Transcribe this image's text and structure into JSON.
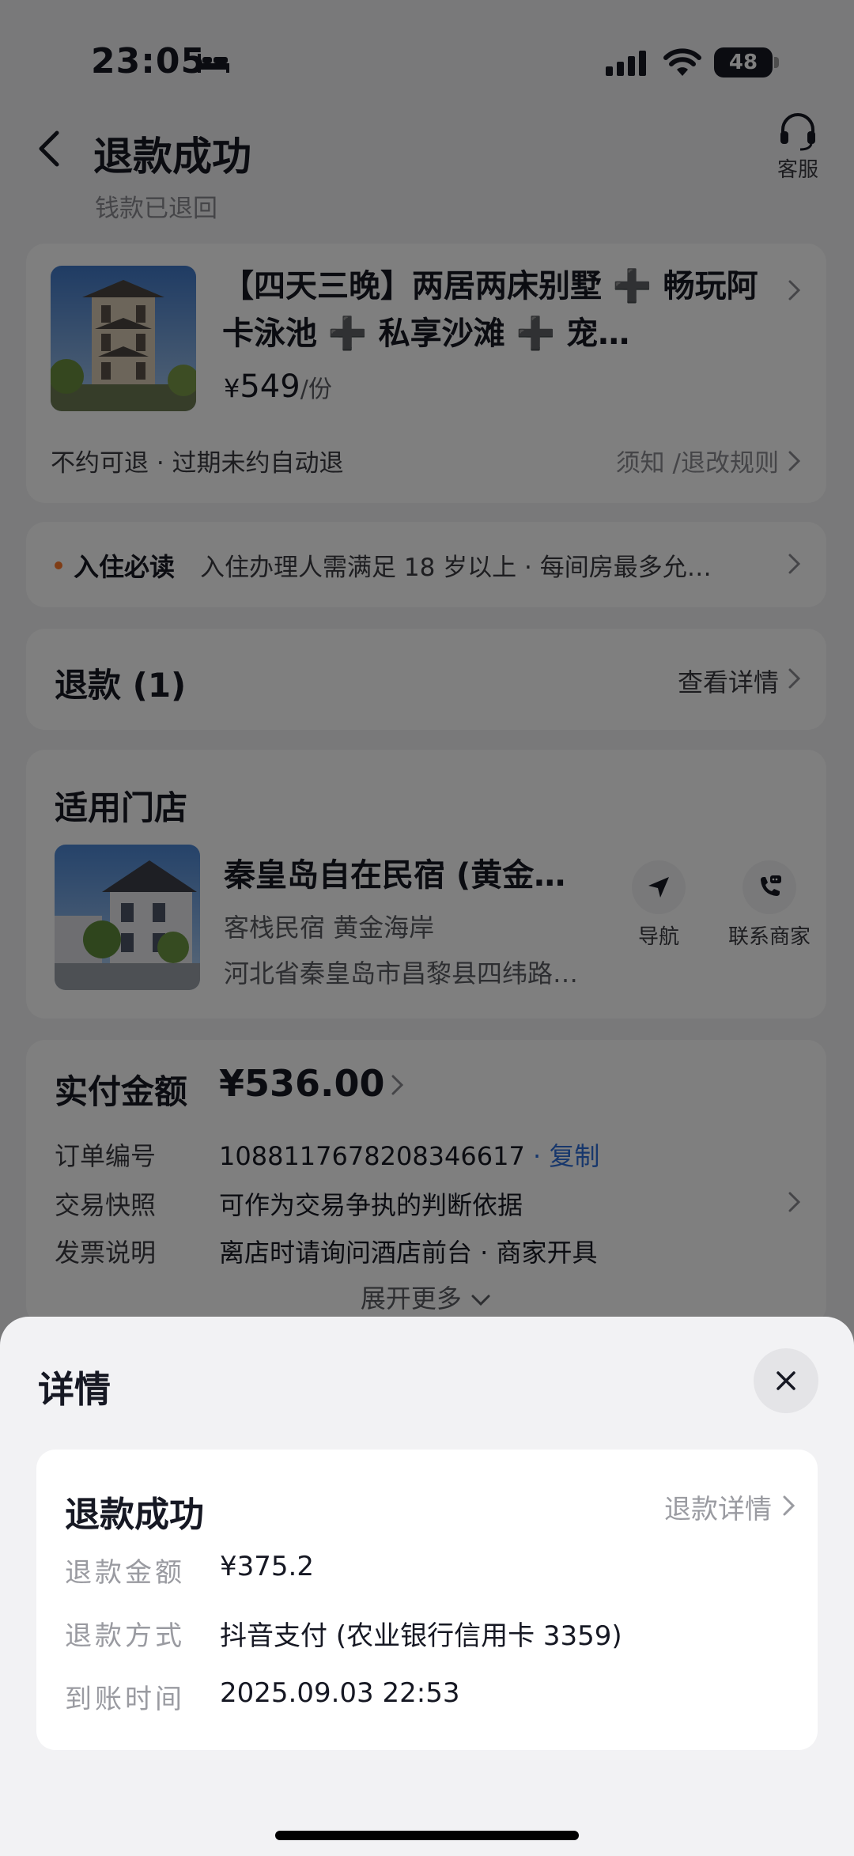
{
  "status_bar": {
    "time": "23:05",
    "battery": "48"
  },
  "header": {
    "title": "退款成功",
    "subtitle": "钱款已退回",
    "service_label": "客服"
  },
  "product": {
    "title": "【四天三晚】两居两床别墅 ➕ 畅玩阿卡泳池 ➕ 私享沙滩 ➕ 宠…",
    "price_symbol": "¥",
    "price": "549",
    "price_unit": "/份",
    "policy": "不约可退 · 过期未约自动退",
    "rules_link": "须知 /退改规则"
  },
  "notice": {
    "label": "入住必读",
    "text": "入住办理人需满足 18 岁以上  ·  每间房最多允…"
  },
  "refund": {
    "title": "退款 (1)",
    "view_label": "查看详情"
  },
  "store": {
    "heading": "适用门店",
    "name": "秦皇岛自在民宿 (黄金…",
    "type": "客栈民宿   黄金海岸",
    "address": "河北省秦皇岛市昌黎县四纬路…",
    "navigate_label": "导航",
    "contact_label": "联系商家"
  },
  "payment": {
    "label": "实付金额",
    "amount": "¥536.00",
    "order_label": "订单编号",
    "order_number": "1088117678208346617",
    "copy_label": "· 复制",
    "snapshot_label": "交易快照",
    "snapshot_text": "可作为交易争执的判断依据",
    "invoice_label": "发票说明",
    "invoice_text": "离店时请询问酒店前台 · 商家开具",
    "expand_label": "展开更多"
  },
  "sheet": {
    "title": "详情",
    "status": "退款成功",
    "detail_link": "退款详情",
    "amount_label": "退款金额",
    "amount": "¥375.2",
    "method_label": "退款方式",
    "method": "抖音支付 (农业银行信用卡 3359)",
    "time_label": "到账时间",
    "time": "2025.09.03 22:53"
  },
  "colors": {
    "accent_blue": "#2f6fd9",
    "notice_dot": "#fe7a2c",
    "overlay": "rgba(0,0,0,0.5)"
  },
  "icons": [
    "bed-icon",
    "signal-icon",
    "wifi-icon",
    "back-icon",
    "headset-icon",
    "chevron-right-icon",
    "navigate-icon",
    "phone-chat-icon",
    "chevron-down-icon",
    "close-icon"
  ]
}
